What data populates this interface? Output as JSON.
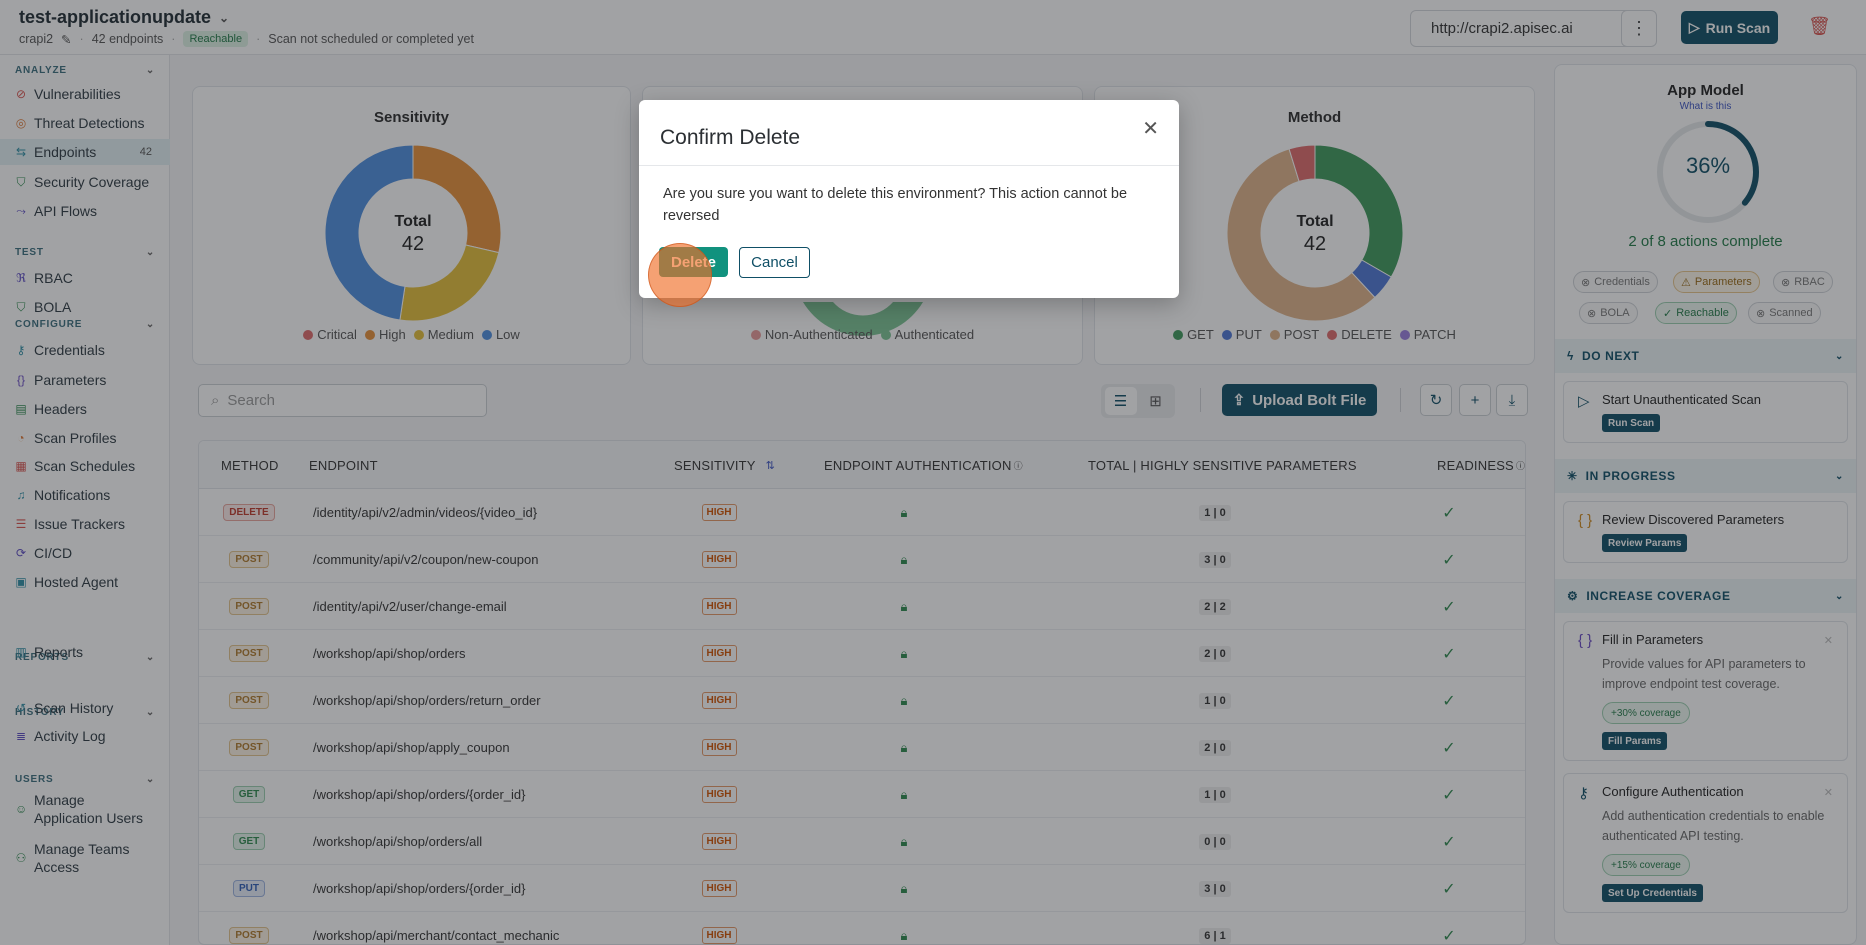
{
  "header": {
    "app_name": "test-applicationupdate",
    "project": "crapi2",
    "endpoints_count": "42 endpoints",
    "reachable_badge": "Reachable",
    "scan_status": "Scan not scheduled or completed yet",
    "url": "http://crapi2.apisec.ai",
    "run_scan_label": "Run Scan"
  },
  "sidebar": {
    "sections": [
      {
        "title": "ANALYZE",
        "items": [
          {
            "label": "Vulnerabilities",
            "icon": "alert-circle-icon"
          },
          {
            "label": "Threat Detections",
            "icon": "target-icon"
          },
          {
            "label": "Endpoints",
            "icon": "endpoints-icon",
            "count": "42",
            "active": true
          },
          {
            "label": "Security Coverage",
            "icon": "shield-icon"
          },
          {
            "label": "API Flows",
            "icon": "flow-icon"
          }
        ]
      },
      {
        "title": "TEST",
        "items": [
          {
            "label": "RBAC",
            "icon": "rbac-icon"
          },
          {
            "label": "BOLA",
            "icon": "shield-icon"
          }
        ]
      },
      {
        "title": "CONFIGURE",
        "items": [
          {
            "label": "Credentials",
            "icon": "key-icon"
          },
          {
            "label": "Parameters",
            "icon": "braces-icon"
          },
          {
            "label": "Headers",
            "icon": "headers-icon"
          },
          {
            "label": "Scan Profiles",
            "icon": "profile-icon"
          },
          {
            "label": "Scan Schedules",
            "icon": "calendar-icon"
          },
          {
            "label": "Notifications",
            "icon": "bell-icon"
          },
          {
            "label": "Issue Trackers",
            "icon": "tracker-icon"
          },
          {
            "label": "CI/CD",
            "icon": "cicd-icon"
          },
          {
            "label": "Hosted Agent",
            "icon": "agent-icon"
          }
        ]
      },
      {
        "title": "REPORTS",
        "items": [
          {
            "label": "Reports",
            "icon": "report-icon"
          }
        ]
      },
      {
        "title": "HISTORY",
        "items": [
          {
            "label": "Scan History",
            "icon": "history-icon"
          },
          {
            "label": "Activity Log",
            "icon": "activity-icon"
          }
        ]
      },
      {
        "title": "USERS",
        "items": [
          {
            "label": "Manage Application Users",
            "icon": "users-icon"
          },
          {
            "label": "Manage Teams Access",
            "icon": "team-icon"
          }
        ]
      }
    ]
  },
  "charts": {
    "sensitivity": {
      "title": "Sensitivity",
      "total_label": "Total",
      "total": "42",
      "legend": [
        {
          "label": "Critical",
          "color": "#e06c6c"
        },
        {
          "label": "High",
          "color": "#e8913a"
        },
        {
          "label": "Medium",
          "color": "#e6c03a"
        },
        {
          "label": "Low",
          "color": "#4f8fe0"
        }
      ],
      "slices": [
        {
          "label": "High",
          "value": 12,
          "color": "#e8913a"
        },
        {
          "label": "Medium",
          "value": 10,
          "color": "#e6c03a"
        },
        {
          "label": "Low",
          "value": 20,
          "color": "#4f8fe0"
        }
      ]
    },
    "auth": {
      "legend": [
        {
          "label": "Non-Authenticated",
          "color": "#e99a9a"
        },
        {
          "label": "Authenticated",
          "color": "#7cc494"
        }
      ]
    },
    "method": {
      "title": "Method",
      "total_label": "Total",
      "total": "42",
      "legend": [
        {
          "label": "GET",
          "color": "#3f9a5c"
        },
        {
          "label": "PUT",
          "color": "#4f78d6"
        },
        {
          "label": "POST",
          "color": "#e0b48a"
        },
        {
          "label": "DELETE",
          "color": "#e06c6c"
        },
        {
          "label": "PATCH",
          "color": "#9b7fe0"
        }
      ],
      "slices": [
        {
          "label": "GET",
          "value": 14,
          "color": "#3f9a5c"
        },
        {
          "label": "PUT",
          "value": 2,
          "color": "#4f78d6"
        },
        {
          "label": "POST",
          "value": 24,
          "color": "#e0b48a"
        },
        {
          "label": "DELETE",
          "value": 2,
          "color": "#e06c6c"
        }
      ]
    }
  },
  "toolbar": {
    "search_placeholder": "Search",
    "upload_label": "Upload Bolt File"
  },
  "table": {
    "headers": [
      "METHOD",
      "ENDPOINT",
      "SENSITIVITY",
      "ENDPOINT AUTHENTICATION",
      "TOTAL | HIGHLY SENSITIVE PARAMETERS",
      "READINESS"
    ],
    "rows": [
      {
        "method": "DELETE",
        "endpoint": "/identity/api/v2/admin/videos/{video_id}",
        "sensitivity": "HIGH",
        "params": "1 | 0"
      },
      {
        "method": "POST",
        "endpoint": "/community/api/v2/coupon/new-coupon",
        "sensitivity": "HIGH",
        "params": "3 | 0"
      },
      {
        "method": "POST",
        "endpoint": "/identity/api/v2/user/change-email",
        "sensitivity": "HIGH",
        "params": "2 | 2"
      },
      {
        "method": "POST",
        "endpoint": "/workshop/api/shop/orders",
        "sensitivity": "HIGH",
        "params": "2 | 0"
      },
      {
        "method": "POST",
        "endpoint": "/workshop/api/shop/orders/return_order",
        "sensitivity": "HIGH",
        "params": "1 | 0"
      },
      {
        "method": "POST",
        "endpoint": "/workshop/api/shop/apply_coupon",
        "sensitivity": "HIGH",
        "params": "2 | 0"
      },
      {
        "method": "GET",
        "endpoint": "/workshop/api/shop/orders/{order_id}",
        "sensitivity": "HIGH",
        "params": "1 | 0"
      },
      {
        "method": "GET",
        "endpoint": "/workshop/api/shop/orders/all",
        "sensitivity": "HIGH",
        "params": "0 | 0"
      },
      {
        "method": "PUT",
        "endpoint": "/workshop/api/shop/orders/{order_id}",
        "sensitivity": "HIGH",
        "params": "3 | 0"
      },
      {
        "method": "POST",
        "endpoint": "/workshop/api/merchant/contact_mechanic",
        "sensitivity": "HIGH",
        "params": "6 | 1"
      }
    ]
  },
  "app_model": {
    "title": "App Model",
    "link": "What is this",
    "progress_text": "36%",
    "progress": 0.36,
    "actions_text": "2 of 8 actions complete",
    "chips": [
      {
        "label": "Credentials",
        "state": "pending"
      },
      {
        "label": "Parameters",
        "state": "warn"
      },
      {
        "label": "RBAC",
        "state": "pending"
      },
      {
        "label": "BOLA",
        "state": "pending"
      },
      {
        "label": "Reachable",
        "state": "ok"
      },
      {
        "label": "Scanned",
        "state": "pending"
      }
    ],
    "do_next": {
      "title": "DO NEXT",
      "card_title": "Start Unauthenticated Scan",
      "button": "Run Scan"
    },
    "in_progress": {
      "title": "IN PROGRESS",
      "card_title": "Review Discovered Parameters",
      "button": "Review Params"
    },
    "increase_coverage": {
      "title": "INCREASE COVERAGE",
      "cards": [
        {
          "title": "Fill in Parameters",
          "desc": "Provide values for API parameters to improve endpoint test coverage.",
          "coverage": "+30% coverage",
          "button": "Fill Params"
        },
        {
          "title": "Configure Authentication",
          "desc": "Add authentication credentials to enable authenticated API testing.",
          "coverage": "+15% coverage",
          "button": "Set Up Credentials"
        }
      ]
    }
  },
  "modal": {
    "title": "Confirm Delete",
    "message": "Are you sure you want to delete this environment? This action cannot be reversed",
    "delete_label": "Delete",
    "cancel_label": "Cancel"
  }
}
